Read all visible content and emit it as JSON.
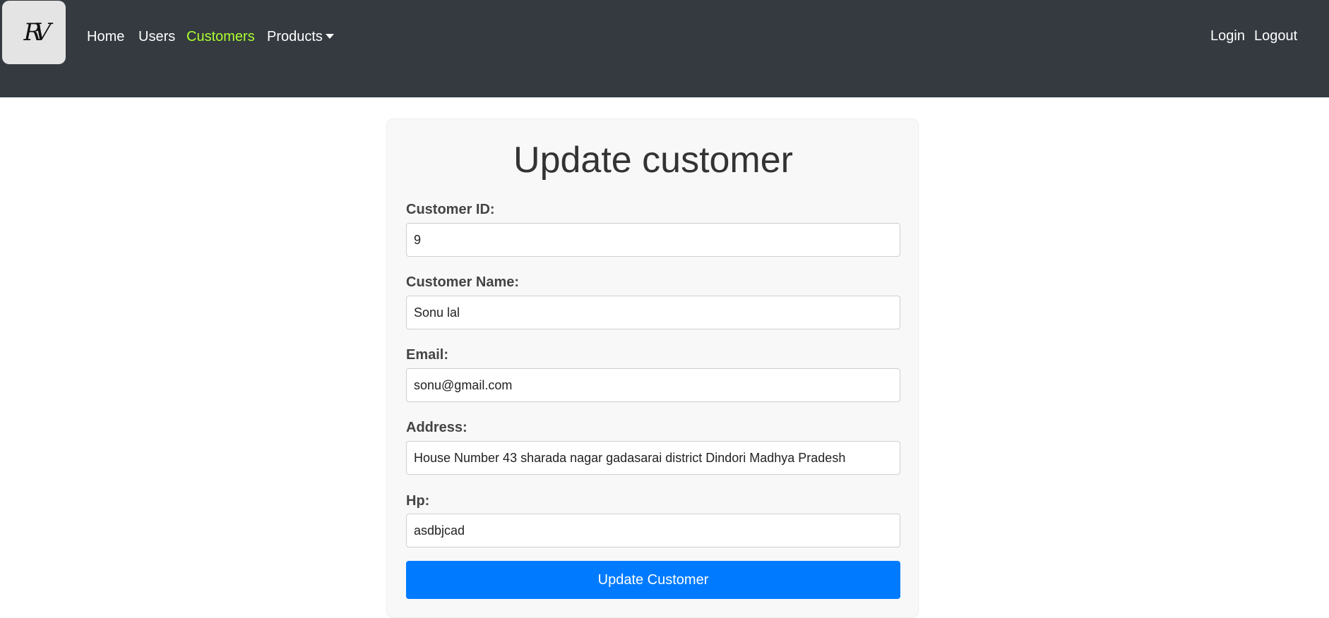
{
  "nav": {
    "logo_text": "RV",
    "links": [
      {
        "label": "Home"
      },
      {
        "label": "Users"
      },
      {
        "label": "Customers"
      },
      {
        "label": "Products"
      }
    ],
    "login": "Login",
    "logout": "Logout",
    "active_color": "#adff2f"
  },
  "form": {
    "title": "Update customer",
    "fields": [
      {
        "label": "Customer ID:",
        "value": "9"
      },
      {
        "label": "Customer Name:",
        "value": "Sonu lal"
      },
      {
        "label": "Email:",
        "value": "sonu@gmail.com"
      },
      {
        "label": "Address:",
        "value": "House Number 43 sharada nagar gadasarai district Dindori Madhya Pradesh"
      },
      {
        "label": "Hp:",
        "value": "asdbjcad"
      }
    ],
    "submit_label": "Update Customer",
    "button_color": "#007bff"
  }
}
